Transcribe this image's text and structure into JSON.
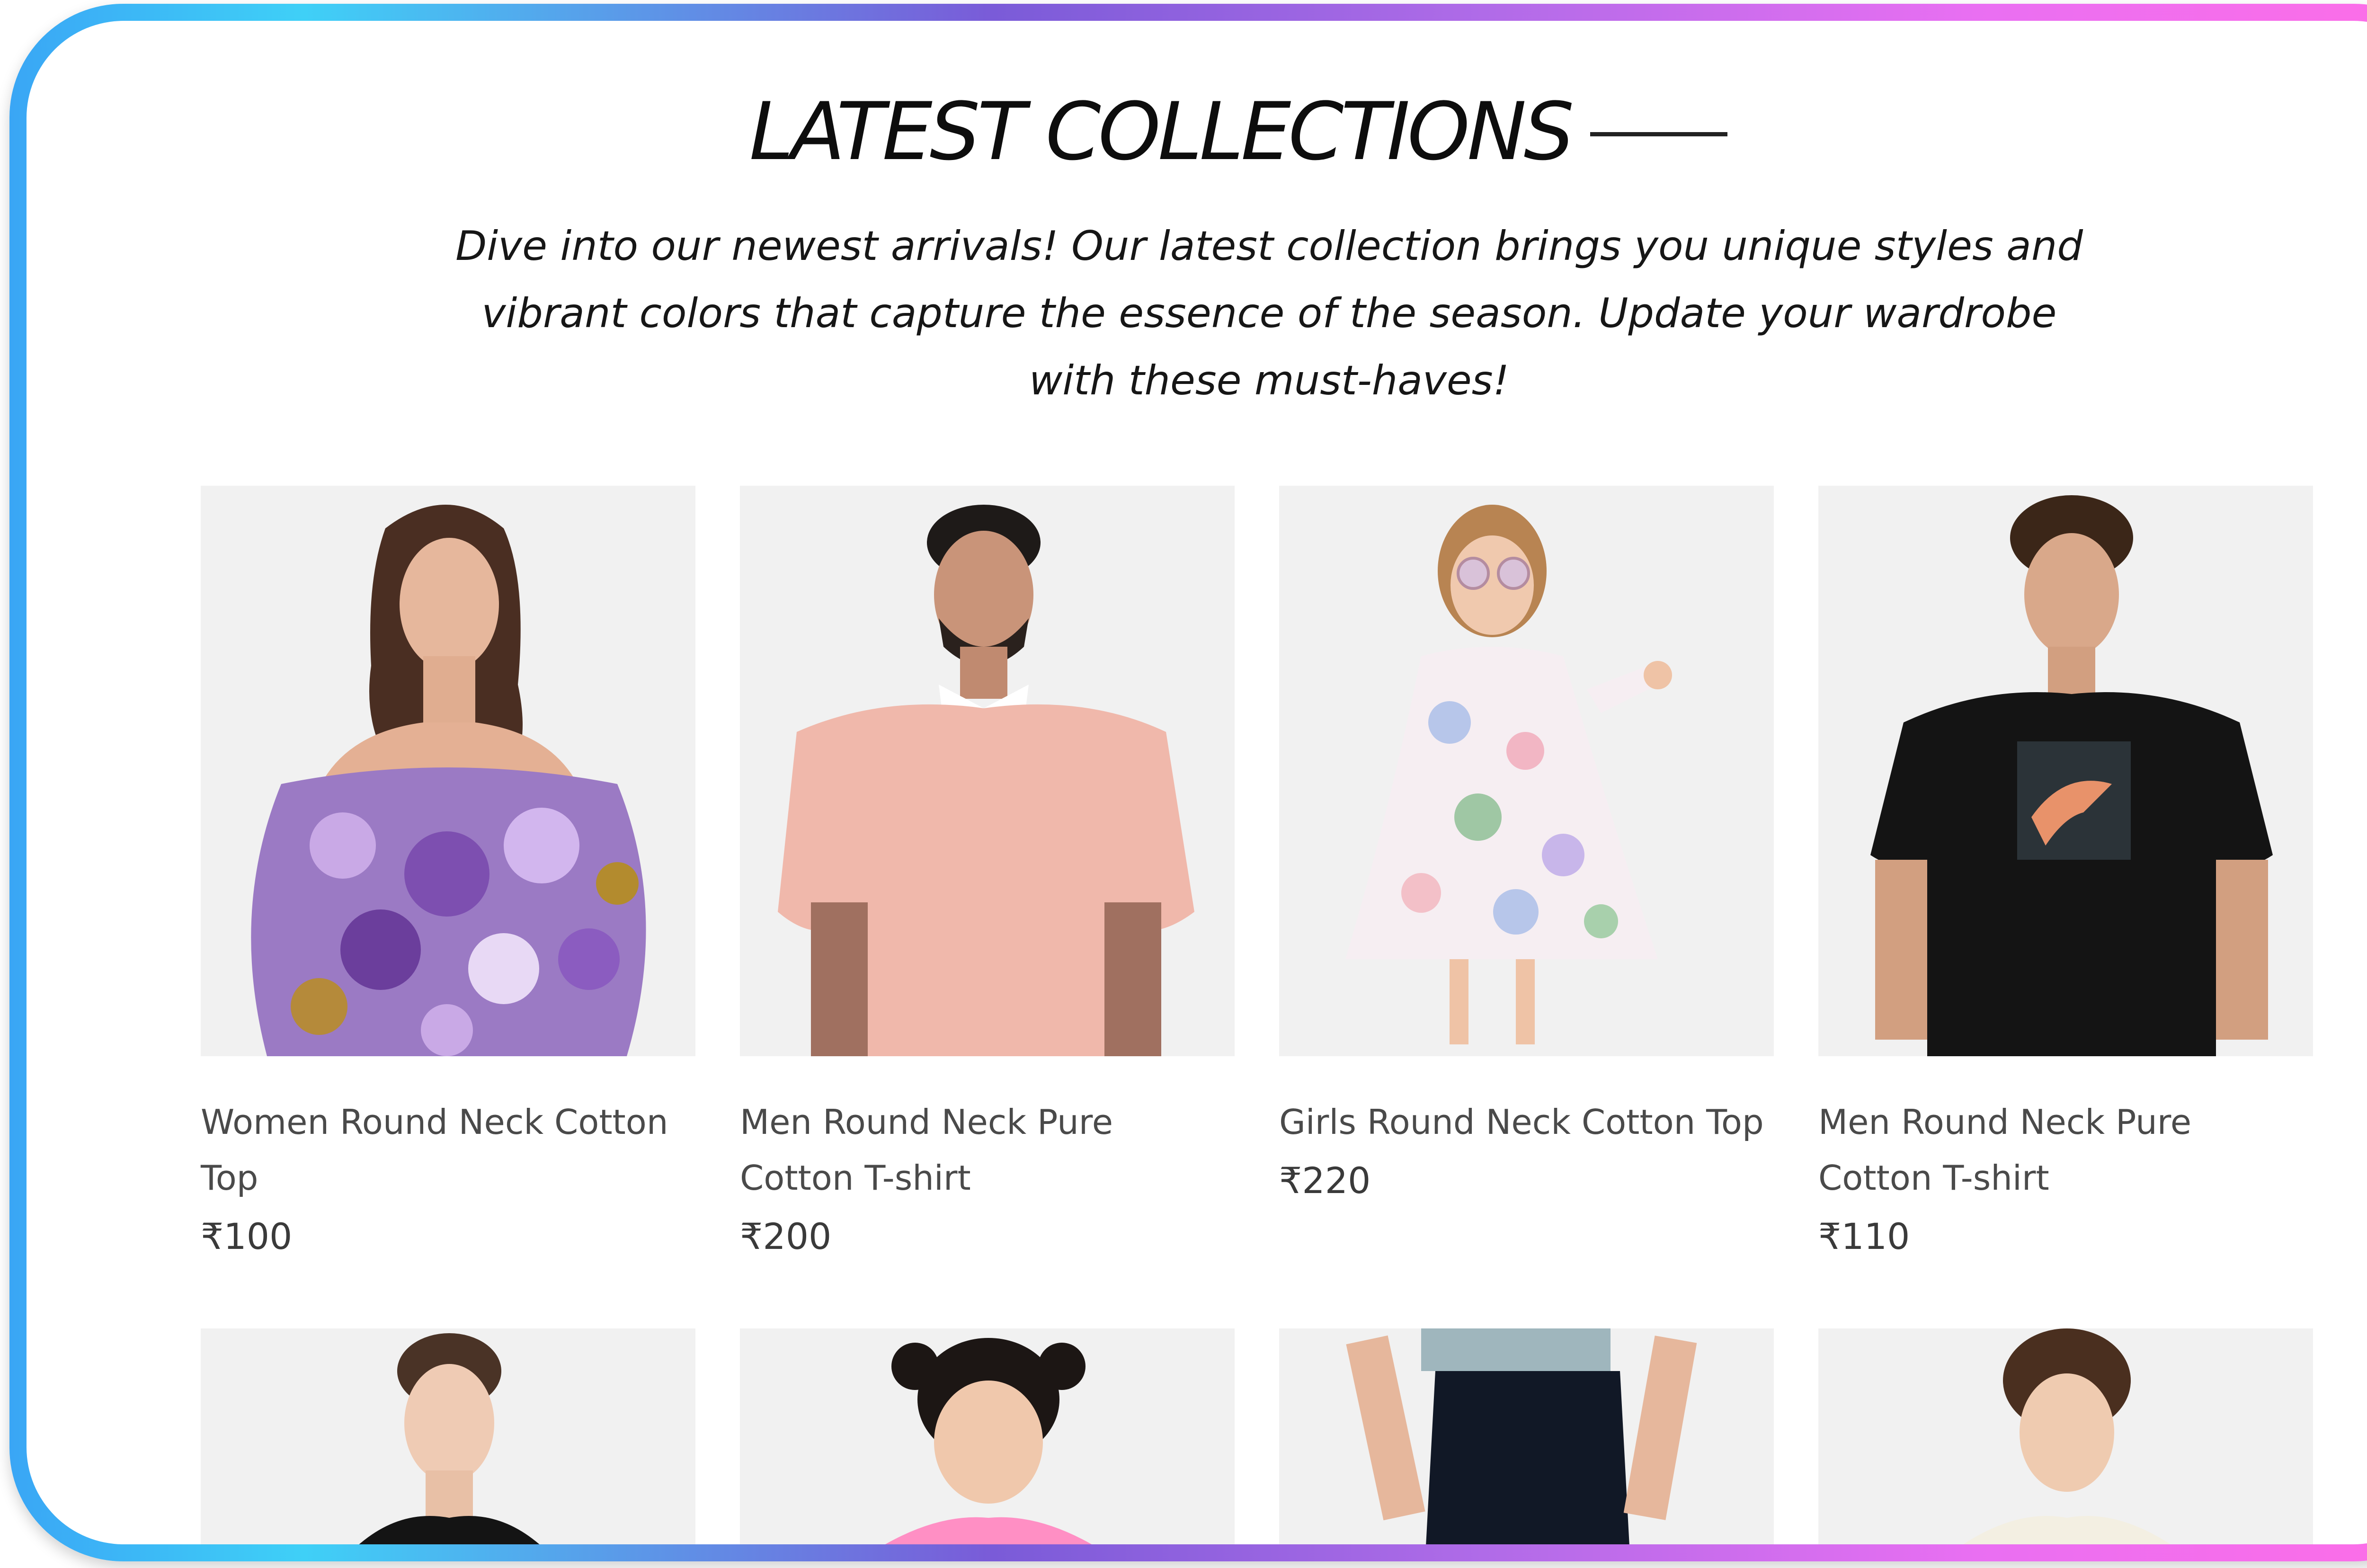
{
  "section": {
    "title": "LATEST COLLECTIONS",
    "subtitle": "Dive into our newest arrivals! Our latest collection brings you unique styles and vibrant colors that capture the essence of the season. Update your wardrobe with these must-haves!"
  },
  "products": [
    {
      "name": "Women Round Neck Cotton Top",
      "price": "₹100"
    },
    {
      "name": "Men Round Neck Pure Cotton T-shirt",
      "price": "₹200"
    },
    {
      "name": "Girls Round Neck Cotton Top",
      "price": "₹220"
    },
    {
      "name": "Men Round Neck Pure Cotton T-shirt",
      "price": "₹110"
    }
  ],
  "colors": {
    "frame_gradient": [
      "#3aa6f5",
      "#7a5bd8",
      "#e96ff2",
      "#ff6ee6"
    ],
    "image_background": "#f1f1f1",
    "text_primary": "#0d0d0d",
    "text_secondary": "#4a4a4a"
  }
}
